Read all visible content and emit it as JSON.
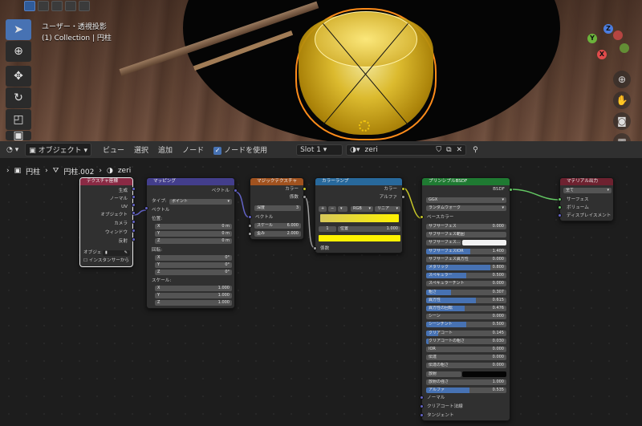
{
  "viewport": {
    "view_label": "ユーザー・透視投影",
    "collection_label": "(1) Collection | 円柱",
    "gizmo_axes": {
      "x": "X",
      "y": "Y",
      "z": "Z"
    },
    "colors": {
      "x": "#e04b4b",
      "y": "#6bb33b",
      "z": "#4b7de0",
      "selection": "#ff8c1a"
    }
  },
  "header": {
    "editor_type_icon": "node-editor-icon",
    "mode": "オブジェクト",
    "menus": [
      "ビュー",
      "選択",
      "追加",
      "ノード"
    ],
    "use_nodes_label": "ノードを使用",
    "slot": "Slot 1",
    "material_name": "zeri"
  },
  "breadcrumb": {
    "object": "円柱",
    "mesh": "円柱.002",
    "material": "zeri"
  },
  "nodes": {
    "texcoord": {
      "title": "テクスチャ座標",
      "outputs": [
        "生成",
        "ノーマル",
        "UV",
        "オブジェクト",
        "カメラ",
        "ウィンドウ",
        "反射"
      ],
      "object_label": "オブジェ",
      "instancer_label": "インスタンサーから"
    },
    "mapping": {
      "title": "マッピング",
      "output": "ベクトル",
      "type_label": "タイプ:",
      "type_value": "ポイント",
      "vector_label": "ベクトル",
      "location_label": "位置:",
      "location": [
        {
          "axis": "X",
          "value": "0 m"
        },
        {
          "axis": "Y",
          "value": "0 m"
        },
        {
          "axis": "Z",
          "value": "0 m"
        }
      ],
      "rotation_label": "回転:",
      "rotation": [
        {
          "axis": "X",
          "value": "0°"
        },
        {
          "axis": "Y",
          "value": "0°"
        },
        {
          "axis": "Z",
          "value": "0°"
        }
      ],
      "scale_label": "スケール:",
      "scale": [
        {
          "axis": "X",
          "value": "1.000"
        },
        {
          "axis": "Y",
          "value": "1.000"
        },
        {
          "axis": "Z",
          "value": "1.000"
        }
      ]
    },
    "magic": {
      "title": "マジックテクスチャ",
      "outputs": [
        "カラー",
        "係数"
      ],
      "depth_label": "深度",
      "depth_value": "3",
      "vector_label": "ベクトル",
      "scale_label": "スケール",
      "scale_value": "6.000",
      "distortion_label": "歪み",
      "distortion_value": "2.000"
    },
    "ramp": {
      "title": "カラーランプ",
      "outputs": [
        "カラー",
        "アルファ"
      ],
      "plus": "+",
      "minus": "−",
      "color_mode": "RGB",
      "interpolation": "リニア",
      "stop_index": "1",
      "position_label": "位置",
      "position_value": "1.000",
      "input": "係数",
      "ramp_color_left": "#d6c85a",
      "ramp_color_right": "#fff200"
    },
    "bsdf": {
      "title": "プリンシプルBSDF",
      "output": "BSDF",
      "distribution": "GGX",
      "sss_method": "ランダムウォーク",
      "base_color_label": "ベースカラー",
      "fields": [
        {
          "label": "サブサーフェス",
          "value": "0.000",
          "fill": 0
        },
        {
          "label": "サブサーフェス範囲",
          "value": "",
          "fill": 0
        },
        {
          "label": "サブサーフェス...",
          "value": "",
          "fill": 0
        },
        {
          "label": "サブサーフェスIOR",
          "value": "1.400",
          "fill": 55
        },
        {
          "label": "サブサーフェス異方性",
          "value": "0.000",
          "fill": 0
        },
        {
          "label": "メタリック",
          "value": "0.800",
          "fill": 80
        },
        {
          "label": "スペキュラー",
          "value": "0.500",
          "fill": 50
        },
        {
          "label": "スペキュラーチント",
          "value": "0.000",
          "fill": 0
        },
        {
          "label": "粗さ",
          "value": "0.307",
          "fill": 31
        },
        {
          "label": "異方性",
          "value": "0.615",
          "fill": 62
        },
        {
          "label": "異方性の回転",
          "value": "0.476",
          "fill": 48
        },
        {
          "label": "シーン",
          "value": "0.000",
          "fill": 0
        },
        {
          "label": "シーンチント",
          "value": "0.500",
          "fill": 50
        },
        {
          "label": "クリアコート",
          "value": "0.145",
          "fill": 15
        },
        {
          "label": "クリアコートの粗さ",
          "value": "0.030",
          "fill": 3
        },
        {
          "label": "IOR",
          "value": "0.000",
          "fill": 0
        },
        {
          "label": "伝達",
          "value": "0.000",
          "fill": 0
        },
        {
          "label": "伝達の粗さ",
          "value": "0.000",
          "fill": 0
        },
        {
          "label": "放射",
          "value": "",
          "fill": 0
        },
        {
          "label": "放射の強さ",
          "value": "1.000",
          "fill": 0
        },
        {
          "label": "アルファ",
          "value": "0.535",
          "fill": 54
        }
      ],
      "bottom_inputs": [
        "ノーマル",
        "クリアコート法線",
        "タンジェント"
      ]
    },
    "output": {
      "title": "マテリアル出力",
      "target": "全て",
      "inputs": [
        "サーフェス",
        "ボリューム",
        "ディスプレイスメント"
      ]
    }
  }
}
